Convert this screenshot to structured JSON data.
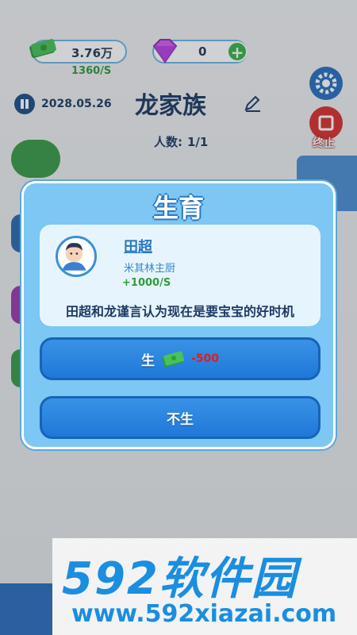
{
  "hud": {
    "money": "3.76万",
    "income_rate": "1360/S",
    "gems": "0",
    "plus_label": "+",
    "date": "2028.05.26",
    "family_name": "龙家族",
    "members_label": "人数:",
    "members_value": "1/1",
    "stop_label": "终止"
  },
  "dialog": {
    "title": "生育",
    "person": {
      "name": "田超",
      "job": "米其林主厨",
      "income": "+1000/S"
    },
    "message": "田超和龙谨言认为现在是要宝宝的好时机",
    "confirm_label": "生",
    "confirm_cost": "-500",
    "decline_label": "不生"
  },
  "watermark": {
    "logo": "592软件园",
    "url": "www.592xiazai.com"
  },
  "colors": {
    "dialog_bg": "#7cc7f3",
    "button_blue": "#1f78d8",
    "income_green": "#2e9d3a",
    "cost_red": "#e11d1d"
  }
}
